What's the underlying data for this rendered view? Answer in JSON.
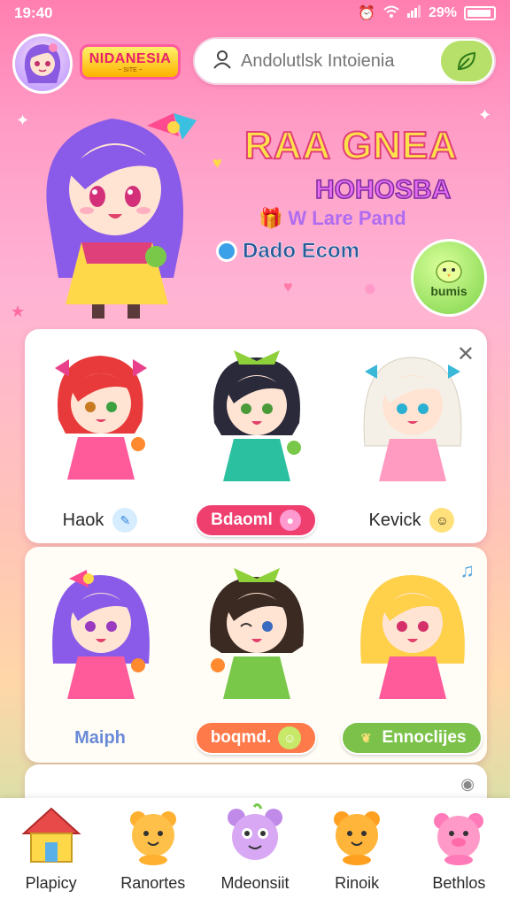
{
  "status": {
    "time": "19:40",
    "battery": "29%"
  },
  "header": {
    "logo_text": "NIDANESIA",
    "logo_sub": "~ SITE ~",
    "search_placeholder": "Andolutlsk Intoienia"
  },
  "hero": {
    "title": "RAA GNEA",
    "subtitle": "HOHOSBA",
    "line1": "W Lare Pand",
    "line2": "Dado Ecom",
    "badge": "bumis"
  },
  "cards": [
    {
      "label": "Haok",
      "style": "plain",
      "icon": "pencil-icon"
    },
    {
      "label": "Bdaoml",
      "style": "pill-red",
      "icon": "blob-icon"
    },
    {
      "label": "Kevick",
      "style": "plain",
      "icon": "smiley-icon"
    },
    {
      "label": "Maiph",
      "style": "plain",
      "icon": "none"
    },
    {
      "label": "boqmd.",
      "style": "pill-orange",
      "icon": "smiley-icon"
    },
    {
      "label": "Ennoclijes",
      "style": "pill-green",
      "icon": "leaf-icon"
    }
  ],
  "nav": [
    {
      "label": "Plapicy",
      "icon": "house-icon"
    },
    {
      "label": "Ranortes",
      "icon": "bear-icon"
    },
    {
      "label": "Mdeonsiit",
      "icon": "monster-icon"
    },
    {
      "label": "Rinoik",
      "icon": "bear-icon"
    },
    {
      "label": "Bethlos",
      "icon": "pig-icon"
    }
  ],
  "colors": {
    "accent": "#ff5aa0",
    "pill_red": "#ef3f6f",
    "pill_orange": "#ff7a4a",
    "pill_green": "#7cc24a",
    "search_button": "#b7e06a"
  }
}
